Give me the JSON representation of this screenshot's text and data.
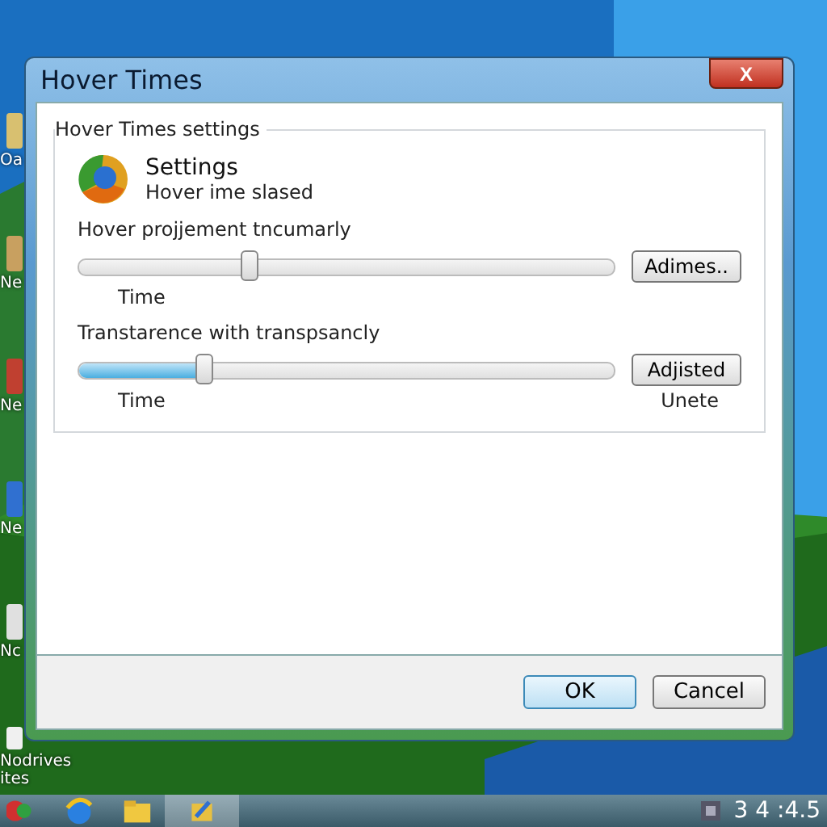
{
  "desktop": {
    "icons": [
      {
        "label": "Oa"
      },
      {
        "label": "Ne"
      },
      {
        "label": "Ne"
      },
      {
        "label": "Ne"
      },
      {
        "label": "Nc"
      },
      {
        "label": "Nodrives ites"
      }
    ]
  },
  "window": {
    "title": "Hover Times",
    "close": "X"
  },
  "group": {
    "title": "Hover Times settings",
    "heading": "Settings",
    "subheading": "Hover ime slased"
  },
  "sliders": [
    {
      "label": "Hover projjement tncumarly",
      "level": 0.32,
      "filled": false,
      "caption": "Time",
      "button": "Adimes.."
    },
    {
      "label": "Transtarence with transpsancly",
      "level": 0.235,
      "filled": true,
      "caption": "Time",
      "button": "Adjisted",
      "note": "Unete"
    }
  ],
  "buttons": [
    {
      "label": "OK",
      "default": true
    },
    {
      "label": "Cancel",
      "default": false
    }
  ],
  "taskbar": {
    "clock": "3 4 :4.5"
  }
}
